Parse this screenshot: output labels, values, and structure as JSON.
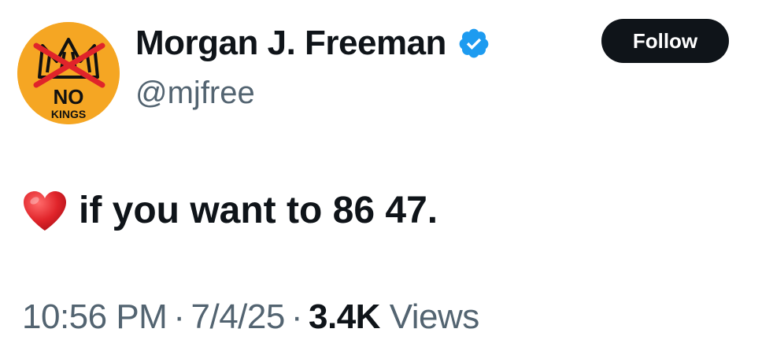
{
  "author": {
    "display_name": "Morgan J. Freeman",
    "handle": "@mjfree",
    "verified": true,
    "avatar_text_1": "NO",
    "avatar_text_2": "KINGS"
  },
  "follow_label": "Follow",
  "tweet": {
    "emoji": "heart-icon",
    "text": "if you want to 86 47."
  },
  "meta": {
    "time": "10:56 PM",
    "separator": "·",
    "date": "7/4/25",
    "views_count": "3.4K",
    "views_label": "Views"
  },
  "colors": {
    "brand_black": "#0f1419",
    "secondary_text": "#536471",
    "verified_blue": "#1d9bf0",
    "avatar_orange": "#f5a623",
    "heart_red": "#e0245e"
  }
}
